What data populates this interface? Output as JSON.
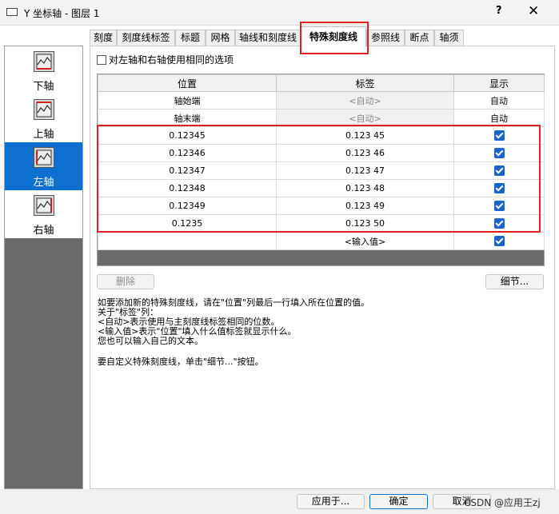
{
  "window": {
    "title": "Y 坐标轴 - 图层 1",
    "help": "?",
    "close": "✕"
  },
  "tabs": [
    {
      "label": "刻度"
    },
    {
      "label": "刻度线标签"
    },
    {
      "label": "标题"
    },
    {
      "label": "网格"
    },
    {
      "label": "轴线和刻度线"
    },
    {
      "label": "特殊刻度线",
      "active": true
    },
    {
      "label": "参照线"
    },
    {
      "label": "断点"
    },
    {
      "label": "轴须"
    }
  ],
  "sidebar": {
    "items": [
      {
        "label": "下轴",
        "icon": "axis-bottom-icon"
      },
      {
        "label": "上轴",
        "icon": "axis-top-icon"
      },
      {
        "label": "左轴",
        "icon": "axis-left-icon",
        "selected": true
      },
      {
        "label": "右轴",
        "icon": "axis-right-icon"
      }
    ]
  },
  "option": {
    "label": "对左轴和右轴使用相同的选项",
    "checked": false
  },
  "table": {
    "headers": [
      "位置",
      "标签",
      "显示"
    ],
    "rows": [
      {
        "position": "轴始端",
        "label": "<自动>",
        "show": "自动"
      },
      {
        "position": "轴末端",
        "label": "<自动>",
        "show": "自动"
      },
      {
        "position": "0.12345",
        "label": "0.123 45",
        "show": "checked"
      },
      {
        "position": "0.12346",
        "label": "0.123 46",
        "show": "checked"
      },
      {
        "position": "0.12347",
        "label": "0.123 47",
        "show": "checked"
      },
      {
        "position": "0.12348",
        "label": "0.123 48",
        "show": "checked"
      },
      {
        "position": "0.12349",
        "label": "0.123 49",
        "show": "checked"
      },
      {
        "position": "0.1235",
        "label": "0.123 50",
        "show": "checked"
      },
      {
        "position": "",
        "label": "<输入值>",
        "show": "checked"
      }
    ]
  },
  "buttons": {
    "delete": "删除",
    "details": "细节...",
    "apply_to": "应用于...",
    "ok": "确定",
    "cancel": "取消"
  },
  "help": {
    "text1": "如要添加新的特殊刻度线，请在\"位置\"列最后一行填入所在位置的值。\n关于\"标签\"列：\n<自动>表示使用与主刻度线标签相同的位数。\n<输入值>表示\"位置\"填入什么值标签就显示什么。\n您也可以输入自己的文本。",
    "text2": "要自定义特殊刻度线，单击\"细节...\"按钮。"
  },
  "watermark": "CSDN @应用王zj",
  "colors": {
    "accent": "#0d6fcf",
    "highlight": "#e02020",
    "checkbox": "#1a64c8"
  }
}
